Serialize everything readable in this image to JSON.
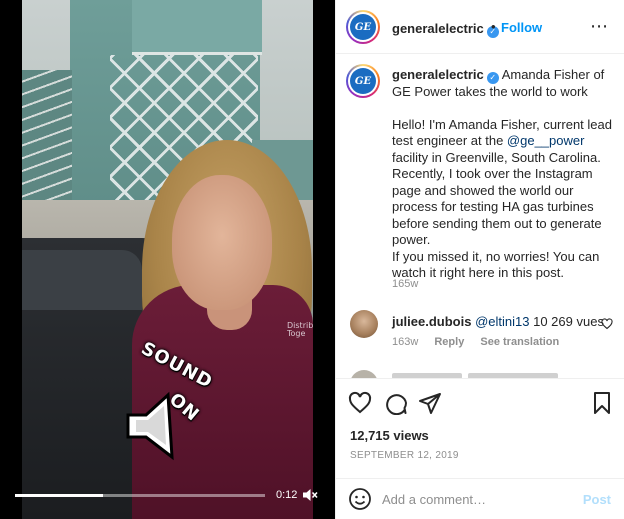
{
  "video": {
    "time": "0:12",
    "progress": 0.35,
    "sticker_line1": "SOUND",
    "sticker_line2": "ON",
    "badge_line1": "Distrib",
    "badge_line2": "Toge",
    "mute_icon": "mute-icon"
  },
  "header": {
    "username": "generalelectric",
    "avatar_text": "GE",
    "separator": "•",
    "follow_label": "Follow",
    "more_label": "⋯"
  },
  "caption": {
    "username": "generalelectric",
    "title": "Amanda Fisher of GE Power takes the world to work",
    "para1_before": "Hello! I'm Amanda Fisher, current lead test engineer at the ",
    "mention": "@ge__power",
    "para1_after": " facility in Greenville, South Carolina. Recently, I took over the Instagram page and showed the world our process for testing HA gas turbines before sending them out to generate power.",
    "para2": "If you missed it, no worries! You can watch it right here in this post.",
    "time": "165w"
  },
  "comment": {
    "username": "juliee.dubois",
    "mention": "@eltini13",
    "text": " 10 269 vues",
    "time": "163w",
    "reply_label": "Reply",
    "translation_label": "See translation"
  },
  "post": {
    "views": "12,715 views",
    "date": "SEPTEMBER 12, 2019"
  },
  "comment_box": {
    "placeholder": "Add a comment…",
    "post_label": "Post"
  },
  "colors": {
    "accent": "#0095f6",
    "post_disabled": "#b2dffc",
    "verified": "#3897f0",
    "ge_blue": "#1b6cc1"
  }
}
